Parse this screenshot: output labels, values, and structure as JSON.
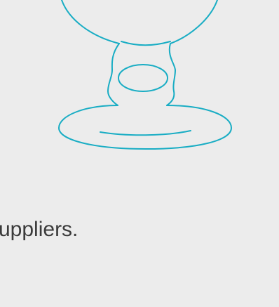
{
  "illustration": {
    "icon": "goblet-icon",
    "stroke_color": "#19adc4"
  },
  "caption": {
    "text": "uppliers."
  }
}
